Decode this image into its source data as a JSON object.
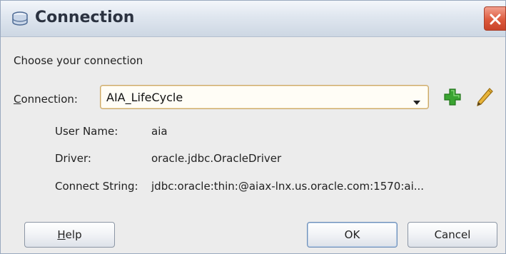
{
  "window": {
    "title": "Connection",
    "title_icon": "database-icon",
    "close_icon": "close-x-icon"
  },
  "prompt": "Choose your connection",
  "connection": {
    "label_mnemonic": "C",
    "label_rest": "onnection:",
    "value": "AIA_LifeCycle",
    "add_icon": "green-plus-icon",
    "edit_icon": "pencil-icon"
  },
  "details": {
    "user_name_label": "User Name:",
    "user_name_value": "aia",
    "driver_label": "Driver:",
    "driver_value": "oracle.jdbc.OracleDriver",
    "connect_string_label": "Connect String:",
    "connect_string_value": "jdbc:oracle:thin:@aiax-lnx.us.oracle.com:1570:ai..."
  },
  "buttons": {
    "help_mnemonic": "H",
    "help_rest": "elp",
    "ok": "OK",
    "cancel": "Cancel"
  },
  "colors": {
    "accent_combo_border": "#c9a86a",
    "close_button": "#dd5a3d",
    "add_icon": "#3aa431",
    "edit_icon": "#d9a320"
  }
}
